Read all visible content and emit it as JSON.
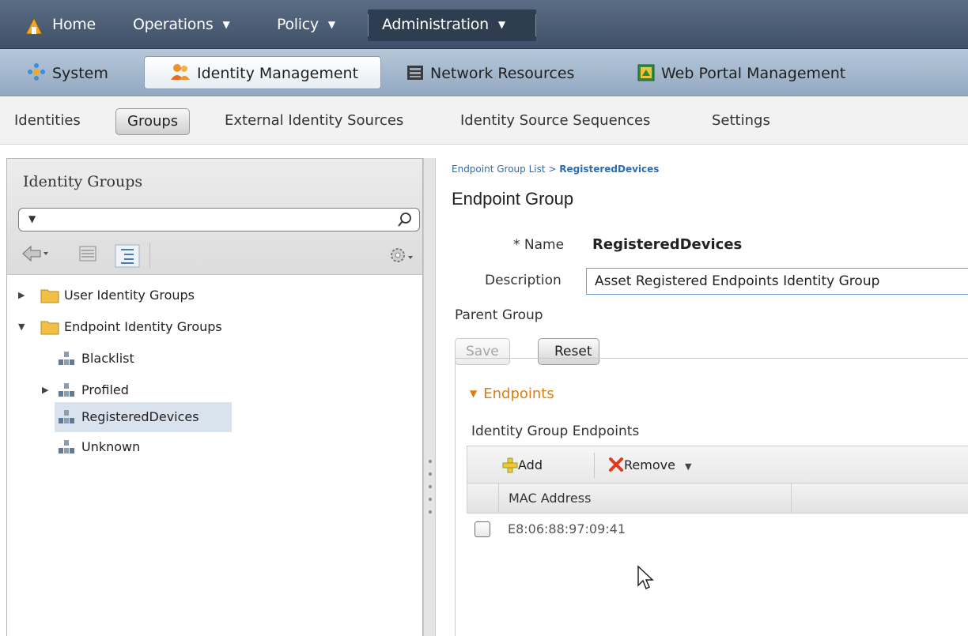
{
  "top_nav": {
    "home": "Home",
    "operations": "Operations",
    "policy": "Policy",
    "administration": "Administration"
  },
  "second_nav": {
    "system": "System",
    "identity_management": "Identity Management",
    "network_resources": "Network Resources",
    "web_portal_management": "Web Portal Management"
  },
  "sub_nav": {
    "identities": "Identities",
    "groups": "Groups",
    "external_identity_sources": "External Identity Sources",
    "identity_source_sequences": "Identity Source Sequences",
    "settings": "Settings"
  },
  "left_panel": {
    "title": "Identity Groups",
    "tree": [
      {
        "label": "User Identity Groups"
      },
      {
        "label": "Endpoint Identity Groups"
      },
      {
        "label": "Blacklist"
      },
      {
        "label": "Profiled"
      },
      {
        "label": "RegisteredDevices"
      },
      {
        "label": "Unknown"
      }
    ]
  },
  "main": {
    "breadcrumb_parent": "Endpoint Group List",
    "breadcrumb_sep": " > ",
    "breadcrumb_current": "RegisteredDevices",
    "title": "Endpoint Group",
    "name_label": "* Name",
    "name_value": "RegisteredDevices",
    "description_label": "Description",
    "description_value": "Asset Registered Endpoints Identity Group",
    "parent_group_label": "Parent Group",
    "save_label": "Save",
    "reset_label": "Reset",
    "endpoints_section": "Endpoints",
    "endpoints_subtitle": "Identity Group Endpoints",
    "add_label": "Add",
    "remove_label": "Remove",
    "column_mac": "MAC Address",
    "rows": [
      {
        "mac": "E8:06:88:97:09:41"
      }
    ]
  },
  "colors": {
    "top_nav_bg": "#4a5b72",
    "second_nav_bg": "#a5b9cf",
    "section_accent": "#e07d10",
    "link": "#2b6db3"
  }
}
